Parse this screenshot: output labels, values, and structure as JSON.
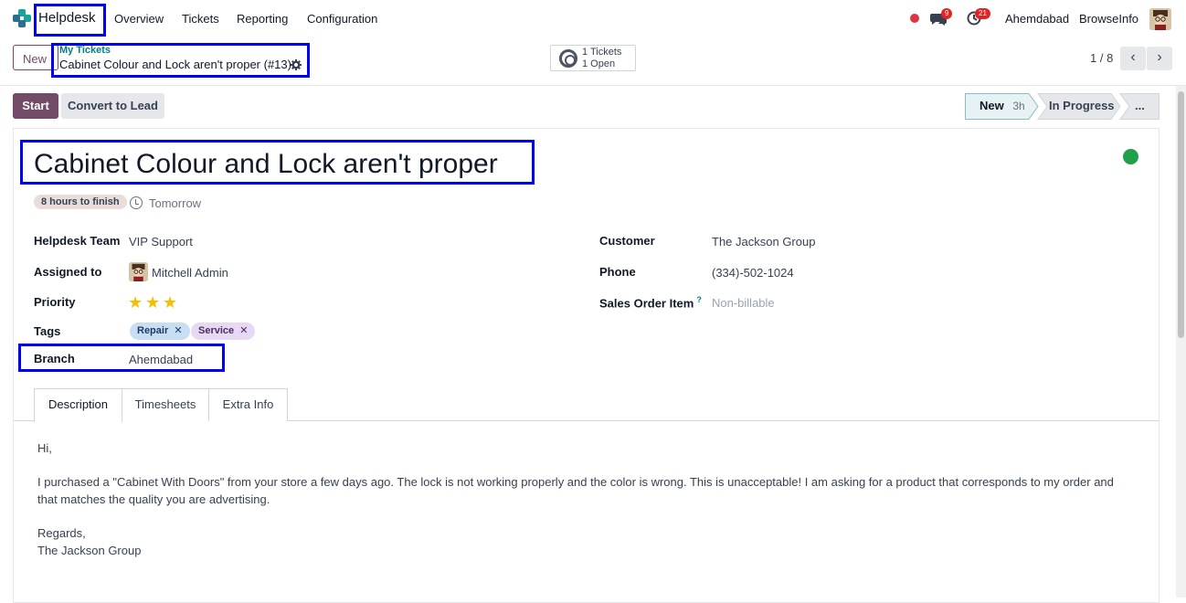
{
  "nav": {
    "app_name": "Helpdesk",
    "menu": [
      "Overview",
      "Tickets",
      "Reporting",
      "Configuration"
    ],
    "chat_count": "9",
    "activity_count": "21",
    "company": "Ahemdabad",
    "company2": "BrowseInfo"
  },
  "control": {
    "new_label": "New",
    "breadcrumb_parent": "My Tickets",
    "breadcrumb_current": "Cabinet Colour and Lock aren't proper (#13)",
    "stat_line1": "1 Tickets",
    "stat_line2": "1 Open",
    "pager": "1 / 8"
  },
  "statusbar": {
    "start_label": "Start",
    "convert_label": "Convert to Lead",
    "stages": [
      {
        "label": "New",
        "extra": "3h"
      },
      {
        "label": "In Progress",
        "extra": ""
      },
      {
        "label": "...",
        "extra": ""
      }
    ]
  },
  "ticket": {
    "title": "Cabinet Colour and Lock aren't proper",
    "sla": "8 hours to finish",
    "deadline": "Tomorrow",
    "fields_left": {
      "team_label": "Helpdesk Team",
      "team_value": "VIP Support",
      "assigned_label": "Assigned to",
      "assigned_value": "Mitchell Admin",
      "priority_label": "Priority",
      "priority_stars": 3,
      "tags_label": "Tags",
      "tags": [
        "Repair",
        "Service"
      ],
      "branch_label": "Branch",
      "branch_value": "Ahemdabad"
    },
    "fields_right": {
      "customer_label": "Customer",
      "customer_value": "The Jackson Group",
      "phone_label": "Phone",
      "phone_value": "(334)-502-1024",
      "sol_label": "Sales Order Item",
      "sol_help": "?",
      "sol_value": "Non-billable"
    },
    "tabs": [
      "Description",
      "Timesheets",
      "Extra Info"
    ],
    "description": {
      "greeting": "Hi,",
      "body": "I purchased a \"Cabinet With Doors\" from your store a few days ago. The lock is not working properly and the color is wrong. This is unacceptable! I am asking for a product that corresponds to my order and that matches the quality you are advertising.",
      "signoff": "Regards,",
      "signature": "The Jackson Group"
    }
  },
  "colors": {
    "primary": "#714b67",
    "teal": "#017e84",
    "stage_active_bg": "#e6f2f3",
    "kanban_done": "#21a04a",
    "highlight": "#0000ee"
  }
}
